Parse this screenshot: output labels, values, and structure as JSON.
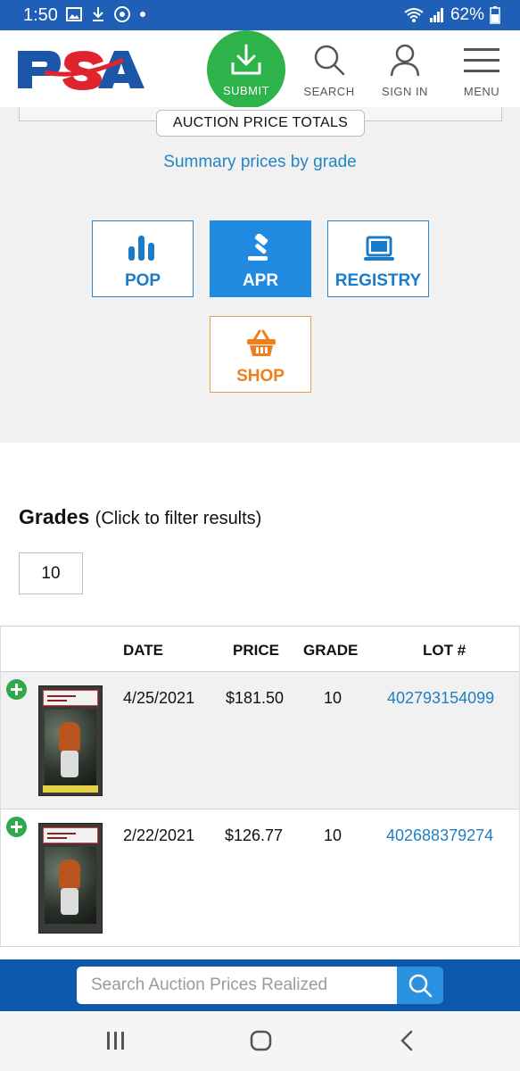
{
  "status_bar": {
    "time": "1:50",
    "battery": "62%",
    "icons": [
      "image-icon",
      "download-icon",
      "chrome-icon",
      "dot-icon",
      "wifi-icon",
      "signal-icon",
      "battery-icon"
    ]
  },
  "header": {
    "logo": "PSA",
    "submit_label": "SUBMIT",
    "search_label": "SEARCH",
    "signin_label": "SIGN IN",
    "menu_label": "MENU"
  },
  "summary_section": {
    "tab_label": "AUCTION PRICE TOTALS",
    "link_text": "Summary prices by grade",
    "tiles": [
      {
        "label": "POP",
        "icon": "bar-chart-icon"
      },
      {
        "label": "APR",
        "icon": "gavel-icon"
      },
      {
        "label": "REGISTRY",
        "icon": "laptop-icon"
      },
      {
        "label": "SHOP",
        "icon": "basket-icon"
      }
    ],
    "active_tile": "APR"
  },
  "grades": {
    "title": "Grades",
    "subtitle": "(Click to filter results)",
    "selected": "10"
  },
  "table": {
    "headers": {
      "date": "DATE",
      "price": "PRICE",
      "grade": "GRADE",
      "lot": "LOT #"
    },
    "rows": [
      {
        "date": "4/25/2021",
        "price": "$181.50",
        "grade": "10",
        "lot": "402793154099"
      },
      {
        "date": "2/22/2021",
        "price": "$126.77",
        "grade": "10",
        "lot": "402688379274"
      }
    ]
  },
  "bottom_search": {
    "placeholder": "Search Auction Prices Realized"
  },
  "colors": {
    "brand_blue": "#1f5fb7",
    "submit_green": "#2db34a",
    "link_blue": "#2386c4",
    "shop_orange": "#ef7f1a"
  }
}
